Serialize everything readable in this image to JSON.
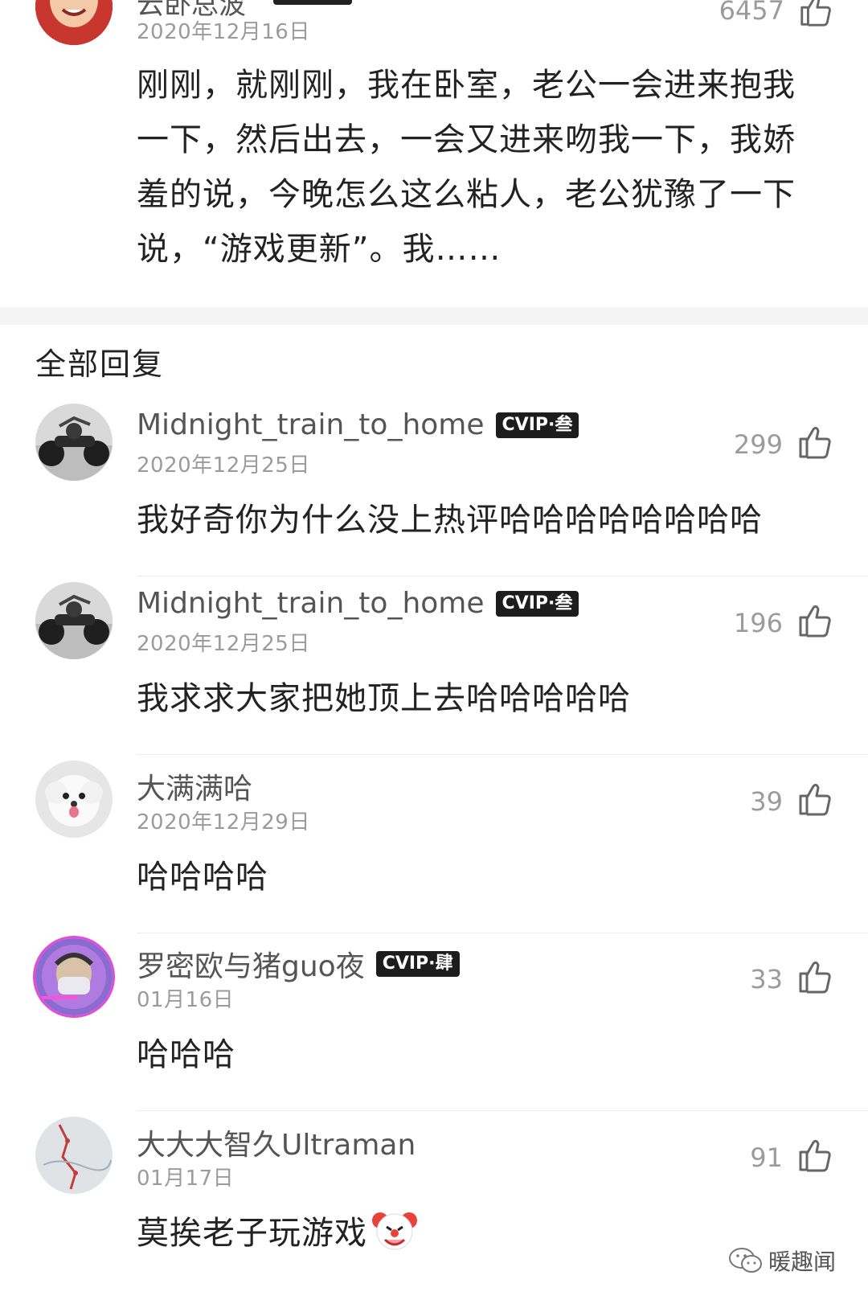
{
  "original_comment": {
    "username": "云卧总波",
    "date": "2020年12月16日",
    "likes": "6457",
    "text": "刚刚，就刚刚，我在卧室，老公一会进来抱我一下，然后出去，一会又进来吻我一下，我娇羞的说，今晚怎么这么粘人，老公犹豫了一下说，“游戏更新”。我……"
  },
  "section_title": "全部回复",
  "replies": [
    {
      "username": "Midnight_train_to_home",
      "vip_badge": "CVIP·叁",
      "date": "2020年12月25日",
      "likes": "299",
      "text": "我好奇你为什么没上热评哈哈哈哈哈哈哈哈",
      "avatar": "motorcycle-avatar"
    },
    {
      "username": "Midnight_train_to_home",
      "vip_badge": "CVIP·叁",
      "date": "2020年12月25日",
      "likes": "196",
      "text": "我求求大家把她顶上去哈哈哈哈哈",
      "avatar": "motorcycle-avatar"
    },
    {
      "username": "大满满哈",
      "vip_badge": "",
      "date": "2020年12月29日",
      "likes": "39",
      "text": "哈哈哈哈",
      "avatar": "dog-avatar"
    },
    {
      "username": "罗密欧与猪guo夜",
      "vip_badge": "CVIP·肆",
      "date": "01月16日",
      "likes": "33",
      "text": "哈哈哈",
      "avatar": "masked-person-avatar"
    },
    {
      "username": "大大大智久Ultraman",
      "vip_badge": "",
      "date": "01月17日",
      "likes": "91",
      "text": "莫挨老子玩游戏",
      "avatar": "map-avatar",
      "emoji": "clown-face-emoji"
    }
  ],
  "watermark": {
    "text": "暖趣闻",
    "icon": "wechat-icon"
  },
  "colors": {
    "text_primary": "#222222",
    "text_secondary": "#9b9b9b",
    "badge_bg": "#1d1d1d",
    "divider": "#f4f4f4"
  }
}
